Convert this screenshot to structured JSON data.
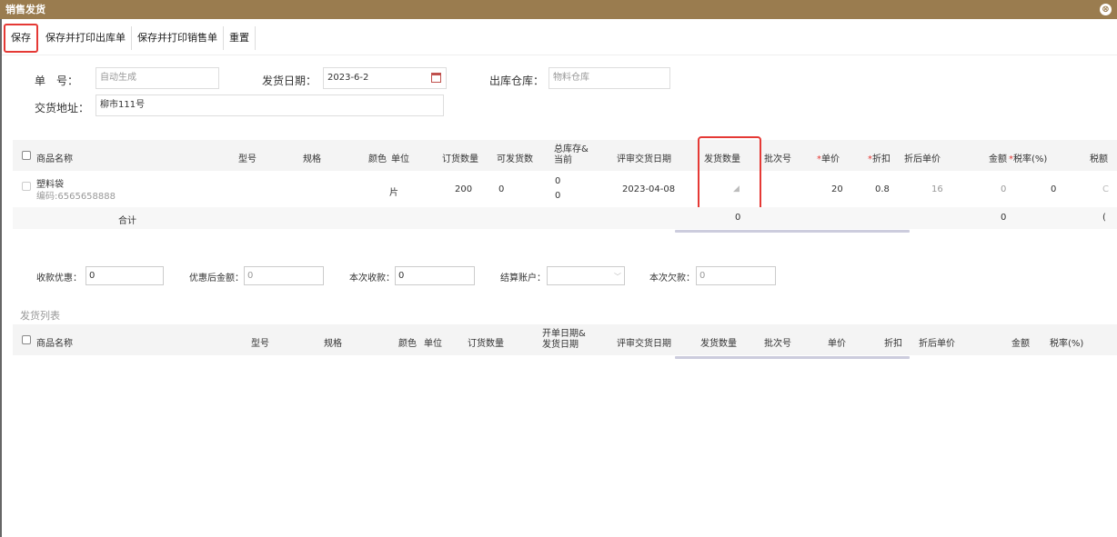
{
  "window": {
    "title": "销售发货",
    "close_glyph": "⊗"
  },
  "toolbar": {
    "save": "保存",
    "save_print_outbound": "保存并打印出库单",
    "save_print_sales": "保存并打印销售单",
    "reset": "重置"
  },
  "form": {
    "order_no_label": "单　号：",
    "order_no_placeholder": "自动生成",
    "ship_date_label": "发货日期：",
    "ship_date_value": "2023-6-2",
    "warehouse_label": "出库仓库：",
    "warehouse_placeholder": "物料仓库",
    "address_label": "交货地址：",
    "address_value": "柳市111号"
  },
  "table": {
    "headers": {
      "name": "商品名称",
      "model": "型号",
      "spec": "规格",
      "color": "颜色",
      "unit": "单位",
      "order_qty": "订货数量",
      "shippable": "可发货数",
      "stock_line1": "总库存&",
      "stock_line2": "当前",
      "review_date": "评审交货日期",
      "ship_qty": "发货数量",
      "batch": "批次号",
      "price": "单价",
      "discount": "折扣",
      "disc_price": "折后单价",
      "amount": "金额",
      "tax_rate": "税率(%)",
      "tax_trunc": "税额",
      "star": "*"
    },
    "rows": [
      {
        "name": "塑料袋",
        "code": "编码:6565658888",
        "unit": "片",
        "order_qty": "200",
        "shippable": "0",
        "stock_total": "0",
        "stock_current": "0",
        "review_date": "2023-04-08",
        "price": "20",
        "discount": "0.8",
        "disc_price": "16",
        "amount": "0",
        "tax_rate": "0",
        "tax_trunc": "C"
      }
    ],
    "summary": {
      "label": "合计",
      "ship_qty": "0",
      "amount": "0",
      "tax_trunc": "("
    }
  },
  "payment": {
    "discount_label": "收款优惠：",
    "discount_value": "0",
    "after_label": "优惠后金额：",
    "after_value": "0",
    "received_label": "本次收款：",
    "received_value": "0",
    "account_label": "结算账户：",
    "account_value": "",
    "owed_label": "本次欠款：",
    "owed_value": "0"
  },
  "ship_list": {
    "title": "发货列表",
    "headers": {
      "name": "商品名称",
      "model": "型号",
      "spec": "规格",
      "color": "颜色",
      "unit": "单位",
      "order_qty": "订货数量",
      "date_line1": "开单日期&",
      "date_line2": "发货日期",
      "review_date": "评审交货日期",
      "ship_qty": "发货数量",
      "batch": "批次号",
      "price": "单价",
      "discount": "折扣",
      "disc_price": "折后单价",
      "amount": "金额",
      "tax_rate": "税率(%)"
    }
  },
  "colors": {
    "titlebar": "#9a7c4f",
    "highlight": "#e53935"
  }
}
